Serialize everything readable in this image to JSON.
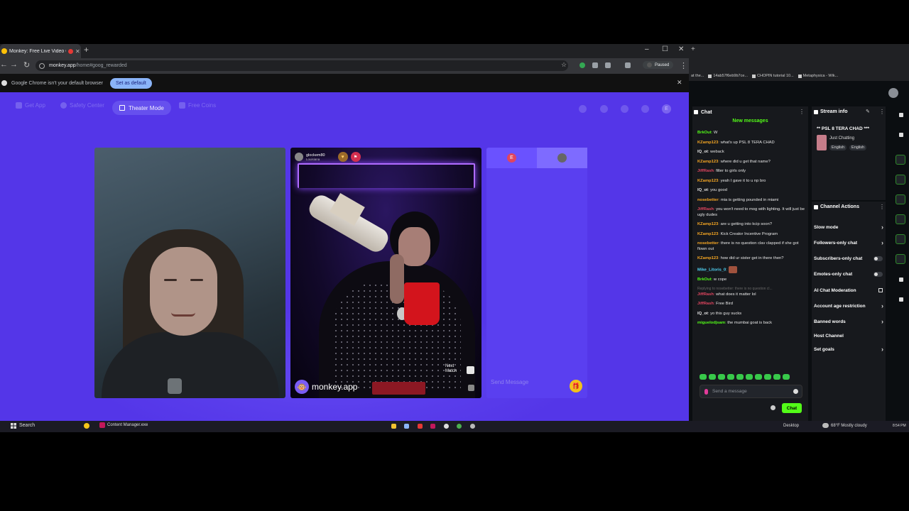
{
  "chrome": {
    "tab_title": "Monkey: Free Live Video Ch",
    "url_domain": "monkey.app",
    "url_path": "/home#goog_rewarded",
    "paused_label": "Paused",
    "infobar_message": "Google Chrome isn't your default browser",
    "set_default_label": "Set as default"
  },
  "monkey": {
    "nav": {
      "get_app": "Get App",
      "safety_center": "Safety Center",
      "theater_mode": "Theater Mode",
      "free_coins": "Free Coins"
    },
    "profile_initial": "E",
    "match_user": {
      "name": "glockem80",
      "location": "Louisiana"
    },
    "logo_text": "monkey.app",
    "next_match": "Next Match",
    "chat": {
      "tab_initial": "E",
      "send_placeholder": "Send Message"
    }
  },
  "taskbar": {
    "search": "Search",
    "app": "Content Manager.exe",
    "desktop": "Desktop",
    "weather": "68°F  Mostly cloudy",
    "time": "8:54 PM"
  },
  "right_browser": {
    "bookmarks": [
      "at the...",
      "14ab57f6eb9b7ce...",
      "CHOPIN tutorial 10...",
      "Metaphysica - Wik..."
    ]
  },
  "kick": {
    "chat_title": "Chat",
    "new_messages": "New messages",
    "messages": [
      {
        "user": "BrkOut",
        "color": "#53fc18",
        "text": "W"
      },
      {
        "user": "KZamp123",
        "color": "#f5a623",
        "text": "what's up PSL 8 TERA CHAD"
      },
      {
        "user": "IQ_ot",
        "color": "#e6e6e6",
        "text": "weback"
      },
      {
        "user": "KZamp123",
        "color": "#f5a623",
        "text": "where did u get that name?"
      },
      {
        "user": "JiffRash",
        "color": "#e0455f",
        "text": "filter to girls only"
      },
      {
        "user": "KZamp123",
        "color": "#f5a623",
        "text": "yeah I gave it to u np bro"
      },
      {
        "user": "IQ_ot",
        "color": "#e6e6e6",
        "text": "you good"
      },
      {
        "user": "nosebetter",
        "color": "#f5a623",
        "text": "mia is getting pounded in miami"
      },
      {
        "user": "JiffRash",
        "color": "#e0455f",
        "text": "you won't need to mog with lighting. It will just be ugly dudes"
      },
      {
        "user": "KZamp123",
        "color": "#f5a623",
        "text": "are u getting into kcip soon?"
      },
      {
        "user": "KZamp123",
        "color": "#f5a623",
        "text": "Kick Creator Incentive Program"
      },
      {
        "user": "nosebetter",
        "color": "#f5a623",
        "text": "there is no question clav clapped if she got flown out"
      },
      {
        "user": "KZamp123",
        "color": "#f5a623",
        "text": "how did ur sister get in there then?"
      },
      {
        "user": "Mike_Litoris_0",
        "color": "#53d8fb",
        "text": ""
      },
      {
        "user": "BrkOut",
        "color": "#53fc18",
        "text": "w cope"
      },
      {
        "reply": "Replying to nosebetter: there is no question cl..."
      },
      {
        "user": "JiffRash",
        "color": "#e0455f",
        "text": "what does it matter lol"
      },
      {
        "user": "JiffRash",
        "color": "#e0455f",
        "text": "Free Bird"
      },
      {
        "user": "IQ_ot",
        "color": "#e6e6e6",
        "text": "yo this guy sucks"
      },
      {
        "user": "miguelodjsam",
        "color": "#53fc18",
        "text": "the mumbai goat is back"
      }
    ],
    "send_placeholder": "Send a message",
    "chat_button": "Chat",
    "stream_info_title": "Stream info",
    "stream_title": "** PSL 8 TERA CHAD ***",
    "category": "Just Chatting",
    "tags": [
      "English",
      "English"
    ],
    "channel_actions_title": "Channel Actions",
    "actions": [
      {
        "label": "Slow mode",
        "type": "chevron"
      },
      {
        "label": "Followers-only chat",
        "type": "chevron"
      },
      {
        "label": "Subscribers-only chat",
        "type": "toggle"
      },
      {
        "label": "Emotes-only chat",
        "type": "toggle"
      },
      {
        "label": "AI Chat Moderation",
        "type": "external"
      },
      {
        "label": "Account age restriction",
        "type": "chevron"
      },
      {
        "label": "Banned words",
        "type": "chevron"
      },
      {
        "label": "Host Channel",
        "type": "none"
      },
      {
        "label": "Set goals",
        "type": "chevron"
      }
    ]
  }
}
